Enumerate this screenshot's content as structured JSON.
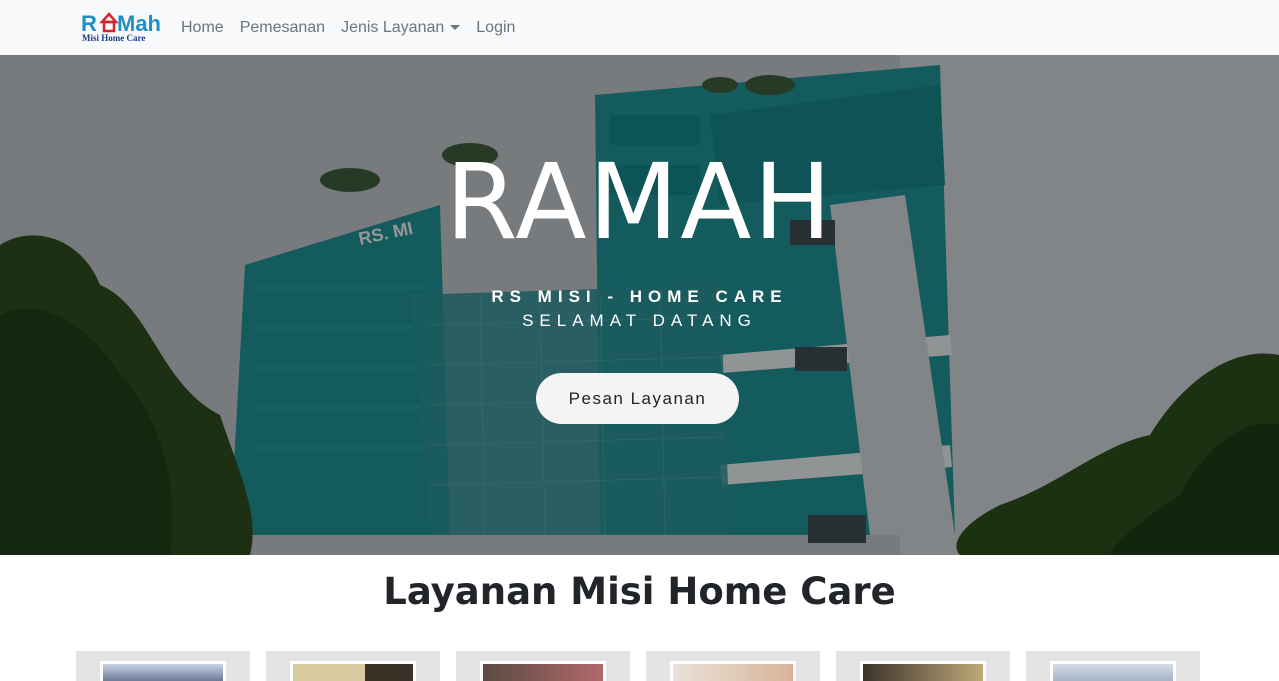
{
  "brand": {
    "logo_word": "RAMah",
    "logo_sub": "Misi Home Care"
  },
  "nav": {
    "items": [
      {
        "label": "Home"
      },
      {
        "label": "Pemesanan"
      },
      {
        "label": "Jenis Layanan"
      },
      {
        "label": "Login"
      }
    ]
  },
  "hero": {
    "title": "RAMAH",
    "subtitle": "RS MISI - HOME CARE",
    "tagline": "SELAMAT DATANG",
    "button_label": "Pesan Layanan"
  },
  "services": {
    "title": "Layanan Misi Home Care",
    "cards": [
      {
        "thumb_color": "#c9d3e6"
      },
      {
        "thumb_color": "#d8cba0"
      },
      {
        "thumb_color": "#8a6a5c"
      },
      {
        "thumb_color": "#e8e2d8"
      },
      {
        "thumb_color": "#3b332b"
      },
      {
        "thumb_color": "#d6dce6"
      }
    ]
  },
  "colors": {
    "navbar_bg": "#f8f9fa",
    "nav_link": "#6c757d",
    "brand_blue": "#1f8fc8",
    "building_teal": "#1f8d8f"
  }
}
